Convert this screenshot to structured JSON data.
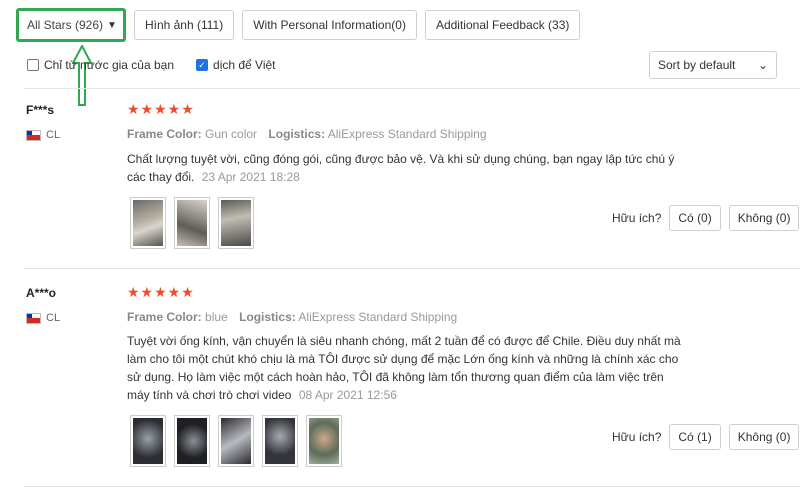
{
  "filters": {
    "all_stars": "All Stars (926)",
    "images": "Hình ảnh (111)",
    "personal_info": "With Personal Information(0)",
    "additional_feedback": "Additional Feedback (33)"
  },
  "options": {
    "own_country": "Chỉ từ nước gia của bạn",
    "translate": "dịch để Việt"
  },
  "sort": {
    "selected": "Sort by default"
  },
  "highlight_color": "#2fa84f",
  "star_color": "#ee4d2d",
  "reviews": [
    {
      "user": "F***s",
      "country": "CL",
      "stars": "★★★★★",
      "frame_label": "Frame Color:",
      "frame_value": "Gun color",
      "logistics_label": "Logistics:",
      "logistics_value": "AliExpress Standard Shipping",
      "text": "Chất lượng tuyệt vời, cũng đóng gói, cũng được bảo vệ. Và khi sử dụng chúng, bạn ngay lập tức chú ý các thay đổi.",
      "date": "23 Apr 2021 18:28",
      "helpful_label": "Hữu ích?",
      "yes": "Có (0)",
      "no": "Không (0)"
    },
    {
      "user": "A***o",
      "country": "CL",
      "stars": "★★★★★",
      "frame_label": "Frame Color:",
      "frame_value": "blue",
      "logistics_label": "Logistics:",
      "logistics_value": "AliExpress Standard Shipping",
      "text": "Tuyệt vời ống kính, vận chuyển là siêu nhanh chóng, mất 2 tuần để có được để Chile. Điều duy nhất mà làm cho tôi một chút khó chịu là mà TÔI được sử dụng để mặc Lớn ống kính và những là chính xác cho sử dụng. Họ làm việc một cách hoàn hảo, TÔI đã không làm tổn thương quan điểm của làm việc trên máy tính và chơi trò chơi video",
      "date": "08 Apr 2021 12:56",
      "helpful_label": "Hữu ích?",
      "yes": "Có (1)",
      "no": "Không (0)"
    }
  ]
}
